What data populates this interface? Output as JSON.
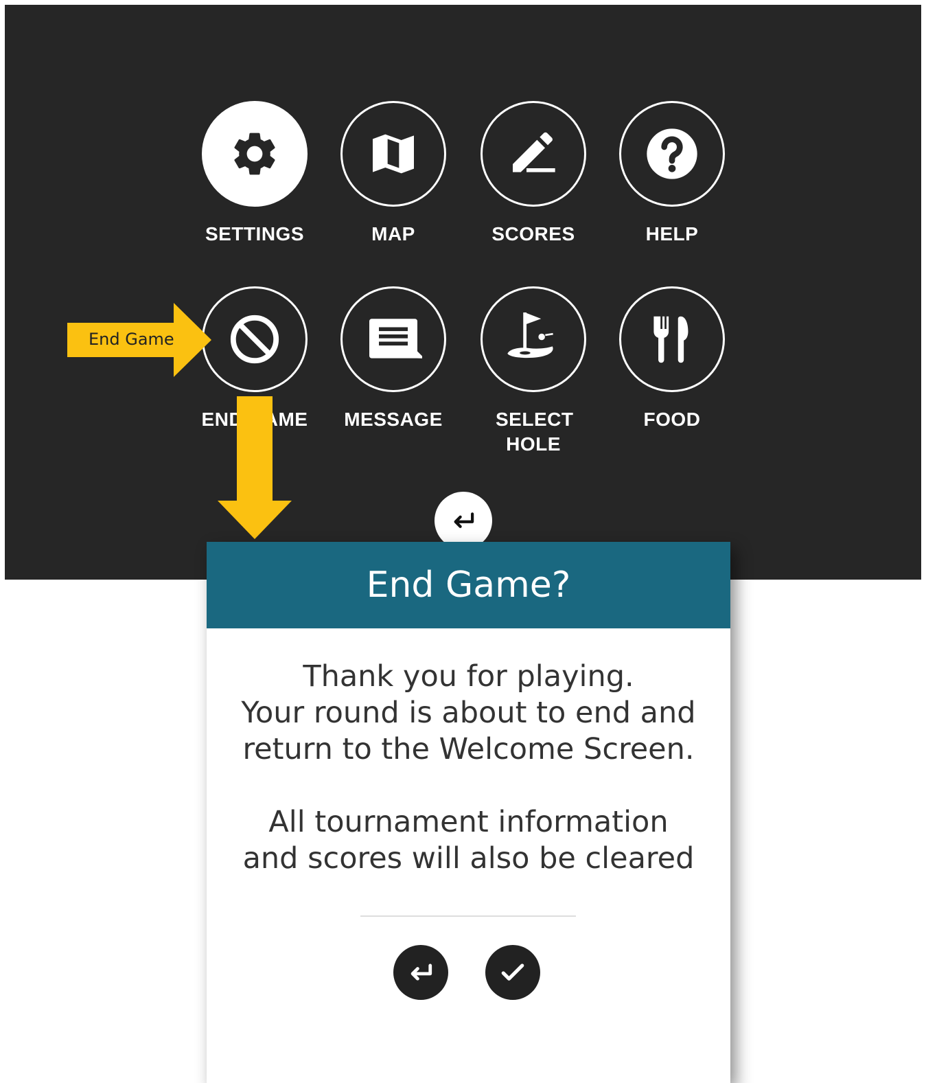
{
  "menu": {
    "items": [
      {
        "label": "SETTINGS",
        "icon": "gear-icon"
      },
      {
        "label": "MAP",
        "icon": "map-icon"
      },
      {
        "label": "SCORES",
        "icon": "pencil-icon"
      },
      {
        "label": "HELP",
        "icon": "question-icon"
      },
      {
        "label": "END GAME",
        "icon": "block-icon"
      },
      {
        "label": "MESSAGE",
        "icon": "message-icon"
      },
      {
        "label": "SELECT HOLE",
        "icon": "golf-flag-icon"
      },
      {
        "label": "FOOD",
        "icon": "fork-knife-icon"
      }
    ],
    "back_icon": "return-icon"
  },
  "callout": {
    "text": "End Game",
    "color": "#fbc111"
  },
  "dialog": {
    "title": "End Game?",
    "message1": [
      "Thank you for playing.",
      "Your round is about to end and",
      "return to the Welcome Screen."
    ],
    "message2": [
      "All tournament information",
      "and scores will also be cleared"
    ],
    "cancel_icon": "return-icon",
    "confirm_icon": "check-icon",
    "header_color": "#1a6880"
  }
}
